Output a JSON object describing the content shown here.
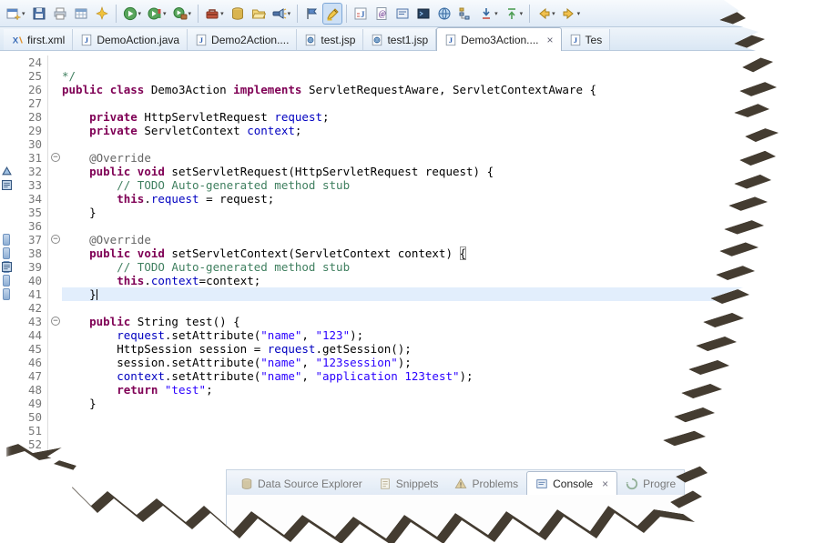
{
  "toolbar": {
    "items": [
      {
        "name": "new",
        "icon": "new",
        "dropdown": true
      },
      {
        "name": "save",
        "icon": "save"
      },
      {
        "name": "print",
        "icon": "print"
      },
      {
        "name": "new-component",
        "icon": "table"
      },
      {
        "name": "new-wizard",
        "icon": "sparkle"
      },
      {
        "sep": true
      },
      {
        "name": "run",
        "icon": "run",
        "dropdown": true
      },
      {
        "name": "coverage",
        "icon": "coverage",
        "dropdown": true
      },
      {
        "name": "run-external",
        "icon": "debug",
        "dropdown": true
      },
      {
        "sep": true
      },
      {
        "name": "external-tools",
        "icon": "tools",
        "dropdown": true
      },
      {
        "name": "data-source",
        "icon": "db"
      },
      {
        "name": "open-folder",
        "icon": "folder"
      },
      {
        "name": "search",
        "icon": "search",
        "dropdown": true
      },
      {
        "sep": true
      },
      {
        "name": "profile-flag",
        "icon": "flag"
      },
      {
        "name": "mark-occurrences",
        "icon": "highlighter",
        "active": true
      },
      {
        "sep": true
      },
      {
        "name": "junit",
        "icon": "junit"
      },
      {
        "name": "javadoc",
        "icon": "javadoc"
      },
      {
        "name": "console-view",
        "icon": "console"
      },
      {
        "name": "terminal",
        "icon": "terminal"
      },
      {
        "name": "web-browser",
        "icon": "globe"
      },
      {
        "name": "type-hierarchy",
        "icon": "hierarchy"
      },
      {
        "name": "import",
        "icon": "down",
        "dropdown": true
      },
      {
        "name": "export",
        "icon": "down2",
        "dropdown": true
      },
      {
        "sep": true
      },
      {
        "name": "back",
        "icon": "back",
        "dropdown": true
      },
      {
        "name": "forward",
        "icon": "forward",
        "dropdown": true
      }
    ]
  },
  "tabs": [
    {
      "label": "first.xml",
      "icon": "xml"
    },
    {
      "label": "DemoAction.java",
      "icon": "java"
    },
    {
      "label": "Demo2Action....",
      "icon": "java"
    },
    {
      "label": "test.jsp",
      "icon": "jsp"
    },
    {
      "label": "test1.jsp",
      "icon": "jsp"
    },
    {
      "label": "Demo3Action....",
      "icon": "java",
      "active": true,
      "closable": true
    },
    {
      "label": "Tes",
      "icon": "java"
    }
  ],
  "editor": {
    "current_line": 41,
    "lines": [
      {
        "n": 24,
        "segs": []
      },
      {
        "n": 25,
        "segs": [
          [
            "com",
            "*/"
          ]
        ]
      },
      {
        "n": 26,
        "segs": [
          [
            "kw",
            "public"
          ],
          [
            "pl",
            " "
          ],
          [
            "kw",
            "class"
          ],
          [
            "pl",
            " Demo3Action "
          ],
          [
            "kw",
            "implements"
          ],
          [
            "pl",
            " ServletRequestAware, ServletContextAware {"
          ]
        ]
      },
      {
        "n": 27,
        "segs": []
      },
      {
        "n": 28,
        "segs": [
          [
            "pl",
            "    "
          ],
          [
            "kw",
            "private"
          ],
          [
            "pl",
            " HttpServletRequest "
          ],
          [
            "fld",
            "request"
          ],
          [
            "pl",
            ";"
          ]
        ]
      },
      {
        "n": 29,
        "segs": [
          [
            "pl",
            "    "
          ],
          [
            "kw",
            "private"
          ],
          [
            "pl",
            " ServletContext "
          ],
          [
            "fld",
            "context"
          ],
          [
            "pl",
            ";"
          ]
        ]
      },
      {
        "n": 30,
        "segs": []
      },
      {
        "n": 31,
        "fold": true,
        "segs": [
          [
            "pl",
            "    "
          ],
          [
            "ann",
            "@Override"
          ]
        ]
      },
      {
        "n": 32,
        "icon": "override",
        "segs": [
          [
            "pl",
            "    "
          ],
          [
            "kw",
            "public"
          ],
          [
            "pl",
            " "
          ],
          [
            "kw",
            "void"
          ],
          [
            "pl",
            " setServletRequest(HttpServletRequest request) {"
          ]
        ]
      },
      {
        "n": 33,
        "icon": "task",
        "segs": [
          [
            "pl",
            "        "
          ],
          [
            "com",
            "// TODO Auto-generated method stub"
          ]
        ]
      },
      {
        "n": 34,
        "segs": [
          [
            "pl",
            "        "
          ],
          [
            "kw",
            "this"
          ],
          [
            "pl",
            "."
          ],
          [
            "fld",
            "request"
          ],
          [
            "pl",
            " = request;"
          ]
        ]
      },
      {
        "n": 35,
        "segs": [
          [
            "pl",
            "    }"
          ]
        ]
      },
      {
        "n": 36,
        "segs": []
      },
      {
        "n": 37,
        "fold": true,
        "bar": true,
        "segs": [
          [
            "pl",
            "    "
          ],
          [
            "ann",
            "@Override"
          ]
        ]
      },
      {
        "n": 38,
        "bar": true,
        "segs": [
          [
            "pl",
            "    "
          ],
          [
            "kw",
            "public"
          ],
          [
            "pl",
            " "
          ],
          [
            "kw",
            "void"
          ],
          [
            "pl",
            " setServletContext(ServletContext context) "
          ],
          [
            "brc",
            "{"
          ]
        ]
      },
      {
        "n": 39,
        "bar": true,
        "icon": "task",
        "segs": [
          [
            "pl",
            "        "
          ],
          [
            "com",
            "// TODO Auto-generated method stub"
          ]
        ]
      },
      {
        "n": 40,
        "bar": true,
        "segs": [
          [
            "pl",
            "        "
          ],
          [
            "kw",
            "this"
          ],
          [
            "pl",
            "."
          ],
          [
            "fld",
            "context"
          ],
          [
            "pl",
            "=context;"
          ]
        ]
      },
      {
        "n": 41,
        "bar": true,
        "hl": true,
        "caret": true,
        "segs": [
          [
            "pl",
            "    }"
          ]
        ]
      },
      {
        "n": 42,
        "segs": []
      },
      {
        "n": 43,
        "fold": true,
        "segs": [
          [
            "pl",
            "    "
          ],
          [
            "kw",
            "public"
          ],
          [
            "pl",
            " String test() {"
          ]
        ]
      },
      {
        "n": 44,
        "segs": [
          [
            "pl",
            "        "
          ],
          [
            "fld",
            "request"
          ],
          [
            "pl",
            ".setAttribute("
          ],
          [
            "str",
            "\"name\""
          ],
          [
            "pl",
            ", "
          ],
          [
            "str",
            "\"123\""
          ],
          [
            "pl",
            ");"
          ]
        ]
      },
      {
        "n": 45,
        "segs": [
          [
            "pl",
            "        HttpSession session = "
          ],
          [
            "fld",
            "request"
          ],
          [
            "pl",
            ".getSession();"
          ]
        ]
      },
      {
        "n": 46,
        "segs": [
          [
            "pl",
            "        session.setAttribute("
          ],
          [
            "str",
            "\"name\""
          ],
          [
            "pl",
            ", "
          ],
          [
            "str",
            "\"123session\""
          ],
          [
            "pl",
            ");"
          ]
        ]
      },
      {
        "n": 47,
        "segs": [
          [
            "pl",
            "        "
          ],
          [
            "fld",
            "context"
          ],
          [
            "pl",
            ".setAttribute("
          ],
          [
            "str",
            "\"name\""
          ],
          [
            "pl",
            ", "
          ],
          [
            "str",
            "\"application 123test\""
          ],
          [
            "pl",
            ");"
          ]
        ]
      },
      {
        "n": 48,
        "segs": [
          [
            "pl",
            "        "
          ],
          [
            "kw",
            "return"
          ],
          [
            "pl",
            " "
          ],
          [
            "str",
            "\"test\""
          ],
          [
            "pl",
            ";"
          ]
        ]
      },
      {
        "n": 49,
        "segs": [
          [
            "pl",
            "    }"
          ]
        ]
      },
      {
        "n": 50,
        "segs": []
      },
      {
        "n": 51,
        "segs": []
      },
      {
        "n": 52,
        "segs": []
      }
    ]
  },
  "bottom_panel": {
    "tabs": [
      {
        "label": "Data Source Explorer",
        "icon": "db"
      },
      {
        "label": "Snippets",
        "icon": "snippets"
      },
      {
        "label": "Problems",
        "icon": "problems"
      },
      {
        "label": "Console",
        "icon": "console",
        "active": true,
        "closable": true
      },
      {
        "label": "Progre",
        "icon": "progress"
      }
    ]
  },
  "colors": {
    "keyword": "#7f0055",
    "string": "#2a00ff",
    "comment": "#3f7f5f",
    "field": "#0000c0",
    "annotation": "#646464",
    "line_number": "#787878",
    "current_line_bg": "#e2eefc",
    "toolbar_bg": "#e8f1fa",
    "active_button_bg": "#cde0f5"
  }
}
